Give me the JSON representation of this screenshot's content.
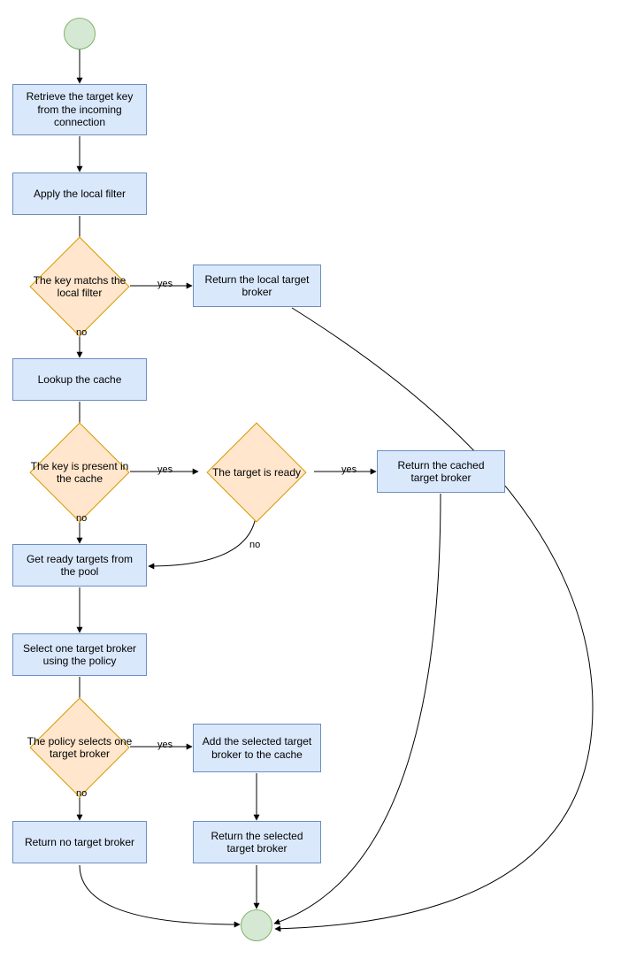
{
  "nodes": {
    "start": "",
    "end": "",
    "retrieve_key": "Retrieve the target key from the incoming connection",
    "apply_filter": "Apply the local filter",
    "key_matches_filter": "The key matchs the local filter",
    "return_local": "Return the local target broker",
    "lookup_cache": "Lookup the cache",
    "key_in_cache": "The key is present in the cache",
    "target_ready": "The target is ready",
    "return_cached": "Return the cached target broker",
    "get_ready_targets": "Get ready targets from the pool",
    "select_target": "Select one target broker using the policy",
    "policy_selects": "The policy selects one target broker",
    "add_to_cache": "Add the selected target broker to the cache",
    "return_no_target": "Return no target broker",
    "return_selected": "Return the selected target broker"
  },
  "edge_labels": {
    "yes": "yes",
    "no": "no"
  },
  "colors": {
    "process_fill": "#DAE8FC",
    "process_stroke": "#6C8EBF",
    "decision_fill": "#FFE6CC",
    "decision_stroke": "#D79B00",
    "terminator_fill": "#D5E8D4",
    "terminator_stroke": "#82B366",
    "edge_stroke": "#000000"
  }
}
